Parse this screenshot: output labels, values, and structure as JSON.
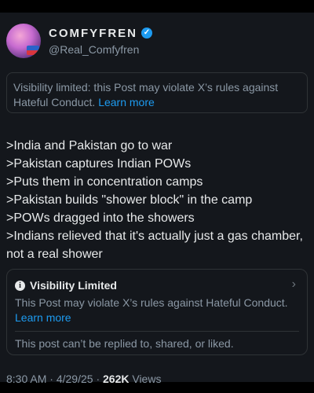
{
  "author": {
    "display_name": "COMFYFREN",
    "handle": "@Real_Comfyfren",
    "verified_icon": "verified-badge-icon"
  },
  "visibility_notice": {
    "text": "Visibility limited: this Post may violate X’s rules against Hateful Conduct.",
    "link": "Learn more"
  },
  "post": {
    "lines": [
      ">India and Pakistan go to war",
      ">Pakistan captures Indian POWs",
      ">Puts them in concentration camps",
      ">Pakistan builds \"shower block\" in the camp",
      ">POWs dragged into the showers",
      ">Indians relieved that it's actually just a gas chamber, not a real shower"
    ]
  },
  "limited_box": {
    "title": "Visibility Limited",
    "body": "This Post may violate X’s rules against Hateful Conduct.",
    "link": "Learn more",
    "footer": "This post can’t be replied to, shared, or liked."
  },
  "meta": {
    "time": "8:30 AM",
    "date": "4/29/25",
    "views_count": "262K",
    "views_label": "Views"
  },
  "colors": {
    "background": "#14171c",
    "accent": "#1d9bf0",
    "muted_text": "#8b98a5"
  }
}
